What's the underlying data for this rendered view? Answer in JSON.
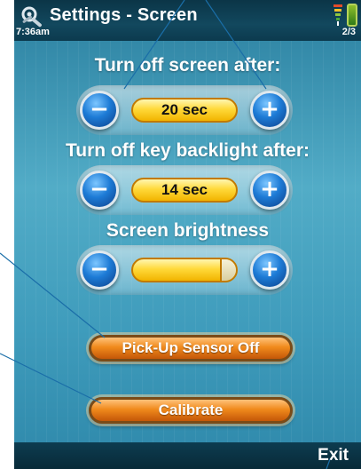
{
  "header": {
    "title": "Settings - Screen",
    "time": "7:36am",
    "page": "2/3"
  },
  "icons": {
    "settings": "wrench-gear-icon",
    "signal": "signal-strength-icon",
    "battery": "battery-icon"
  },
  "screen_timeout": {
    "label": "Turn off screen after:",
    "value": "20 sec",
    "minus": "−",
    "plus": "+"
  },
  "key_backlight": {
    "label": "Turn off key backlight after:",
    "value": "14 sec",
    "minus": "−",
    "plus": "+"
  },
  "brightness": {
    "label": "Screen brightness",
    "level": 0.86,
    "minus": "−",
    "plus": "+"
  },
  "buttons": {
    "pickup_sensor": "Pick-Up Sensor Off",
    "calibrate": "Calibrate"
  },
  "softkeys": {
    "right": "Exit"
  },
  "colors": {
    "accent_orange": "#f08a1c",
    "value_yellow": "#ffd93a",
    "button_blue": "#1d7bd6",
    "bar_dark": "#0b3547"
  }
}
